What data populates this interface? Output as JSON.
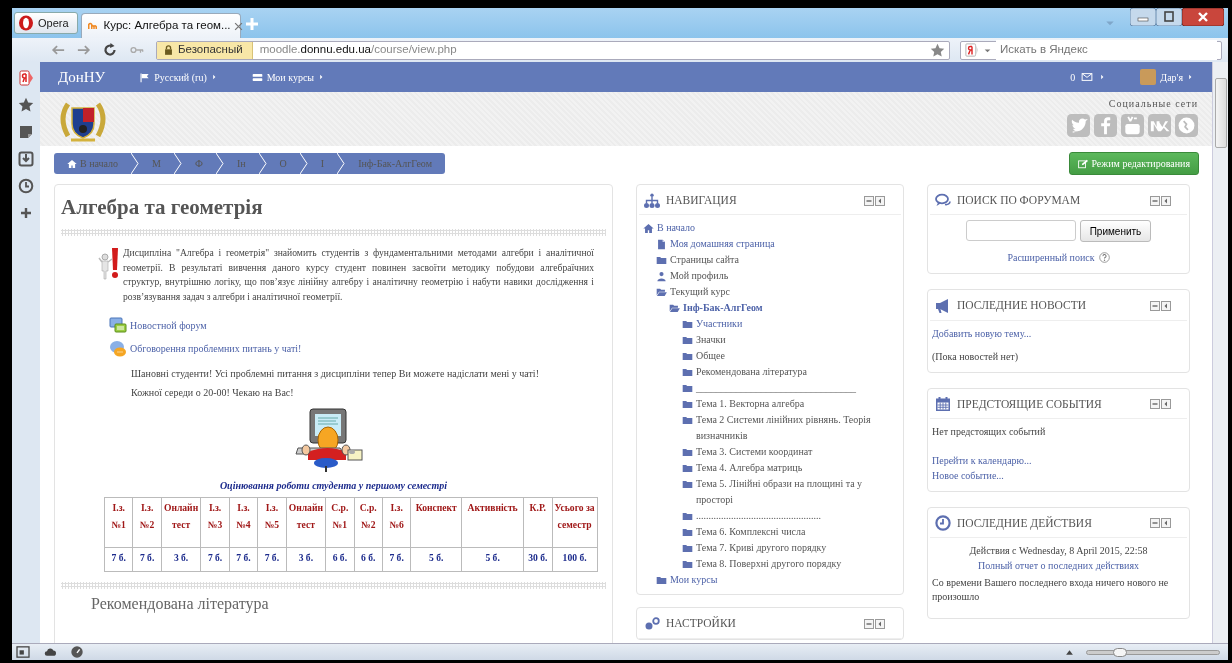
{
  "browser": {
    "menu_button": "Opera",
    "tabs": [
      {
        "label": "Курс: Алгебра та геом...",
        "selected": true
      }
    ],
    "security": "Безопасный",
    "url": "moodle.**donnu.edu.ua**/course/view.php",
    "search": {
      "placeholder": "Искать в Яндекс"
    },
    "zoom": {
      "level": 0.25
    }
  },
  "navbar": {
    "brand": "ДонНУ",
    "menus": [
      {
        "label": "Русский (ru)",
        "kind": "language"
      },
      {
        "label": "Мои курсы",
        "kind": "courses"
      }
    ],
    "messages": "0",
    "user": "Дар'я"
  },
  "header": {
    "social_title": "Социальные сети"
  },
  "breadcrumb": [
    "В начало",
    "М",
    "Ф",
    "Ін",
    "О",
    "І",
    "Інф-Бак-АлгГеом"
  ],
  "edit_button": "Режим редактирования",
  "course": {
    "title": "Алгебра та геометрія",
    "description": "Дисципліна \"Алгебра і геометрія\" знайомить студентів з фундаментальними методами алгебри і аналітичної геометрії. В результаті вивчення даного курсу студент повинен засвоїти методику побудови алгебраїчних структур, внутрішню логіку, що пов’язує лінійну алгебру і аналітичну геометрію і набути навики дослідження і розв’язування задач з алгебри і аналітичної геометрії.",
    "activities": [
      {
        "label": "Новостной форум",
        "kind": "forum"
      },
      {
        "label": "Обговорення проблемних питань у чаті!",
        "kind": "chat"
      }
    ],
    "notice": [
      "Шановні студенти! Усі проблемні питання з дисципліни тепер Ви можете надіслати мені у чаті!",
      "Кожної середи о 20-00! Чекаю на Вас!"
    ],
    "table_caption": "Оцінювання роботи студента у першому семестрі",
    "table": {
      "columns": [
        "І.з. №1",
        "І.з. №2",
        "Онлайн тест",
        "І.з. №3",
        "І.з. №4",
        "І.з. №5",
        "Онлайн тест",
        "С.р. №1",
        "С.р. №2",
        "І.з. №6",
        "Конспект",
        "Активність",
        "К.Р.",
        "Усього за семестр"
      ],
      "rows": [
        [
          "7 б.",
          "7 б.",
          "3 б.",
          "7 б.",
          "7 б.",
          "7 б.",
          "3 б.",
          "6 б.",
          "6 б.",
          "7 б.",
          "5 б.",
          "5 б.",
          "30 б.",
          "100 б."
        ]
      ]
    },
    "next_section": "Рекомендована література"
  },
  "navigation": {
    "title": "НАВИГАЦИЯ",
    "tree": [
      {
        "label": "В начало",
        "kind": "home",
        "link": true,
        "children": [
          {
            "label": "Моя домашняя страница",
            "kind": "page",
            "link": true
          },
          {
            "label": "Страницы сайта",
            "kind": "folder",
            "link": false
          },
          {
            "label": "Мой профиль",
            "kind": "user",
            "link": false
          },
          {
            "label": "Текущий курс",
            "kind": "folder-open",
            "link": false,
            "children": [
              {
                "label": "Інф-Бак-АлгГеом",
                "kind": "folder-open",
                "link": true,
                "current": true,
                "children": [
                  {
                    "label": "Участники",
                    "kind": "folder",
                    "link": true
                  },
                  {
                    "label": "Значки",
                    "kind": "folder",
                    "link": false
                  },
                  {
                    "label": "Общее",
                    "kind": "folder",
                    "link": false
                  },
                  {
                    "label": "Рекомендована література",
                    "kind": "folder",
                    "link": false
                  },
                  {
                    "label": "________________________________",
                    "kind": "folder",
                    "link": false
                  },
                  {
                    "label": "Тема 1. Векторна алгебра",
                    "kind": "folder",
                    "link": false
                  },
                  {
                    "label": "Тема 2 Системи лінійних рівнянь. Теорія визначників",
                    "kind": "folder",
                    "link": false
                  },
                  {
                    "label": "Тема 3. Системи координат",
                    "kind": "folder",
                    "link": false
                  },
                  {
                    "label": "Тема 4. Алгебра матриць",
                    "kind": "folder",
                    "link": false
                  },
                  {
                    "label": "Тема 5. Лінійні образи на площині та у просторі",
                    "kind": "folder",
                    "link": false
                  },
                  {
                    "label": "..................................................",
                    "kind": "folder",
                    "link": false
                  },
                  {
                    "label": "Тема 6. Комплексні числа",
                    "kind": "folder",
                    "link": false
                  },
                  {
                    "label": "Тема 7. Криві другого порядку",
                    "kind": "folder",
                    "link": false
                  },
                  {
                    "label": "Тема 8. Поверхні другого порядку",
                    "kind": "folder",
                    "link": false
                  }
                ]
              }
            ]
          },
          {
            "label": "Мои курсы",
            "kind": "folder",
            "link": true
          }
        ]
      }
    ]
  },
  "settings_block": {
    "title": "НАСТРОЙКИ"
  },
  "forum_search": {
    "title": "ПОИСК ПО ФОРУМАМ",
    "button": "Применить",
    "advanced": "Расширенный поиск"
  },
  "news": {
    "title": "ПОСЛЕДНИЕ НОВОСТИ",
    "add_link": "Добавить новую тему...",
    "empty": "(Пока новостей нет)"
  },
  "events": {
    "title": "ПРЕДСТОЯЩИЕ СОБЫТИЯ",
    "empty": "Нет предстоящих событий",
    "links": [
      "Перейти к календарю...",
      "Новое событие..."
    ]
  },
  "activity": {
    "title": "ПОСЛЕДНИЕ ДЕЙСТВИЯ",
    "since": "Действия с Wednesday, 8 April 2015, 22:58",
    "report_link": "Полный отчет о последних действиях",
    "message": "Со времени Вашего последнего входа ничего нового не произошло"
  }
}
